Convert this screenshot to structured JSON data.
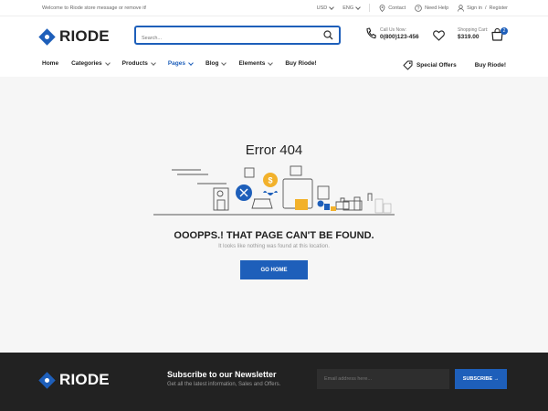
{
  "topbar": {
    "welcome": "Welcome to Riode store message or remove it!",
    "currency": "USD",
    "language": "ENG",
    "contact": "Contact",
    "help": "Need Help",
    "signin": "Sign in",
    "slash": "/",
    "register": "Register"
  },
  "header": {
    "logo": "RIODE",
    "search_placeholder": "Search...",
    "call_label": "Call Us Now:",
    "phone": "0(800)123-456",
    "cart_label": "Shopping Cart:",
    "cart_total": "$319.00",
    "cart_count": "2"
  },
  "nav": {
    "items": [
      {
        "label": "Home"
      },
      {
        "label": "Categories"
      },
      {
        "label": "Products"
      },
      {
        "label": "Pages"
      },
      {
        "label": "Blog"
      },
      {
        "label": "Elements"
      },
      {
        "label": "Buy Riode!"
      }
    ],
    "special_offers": "Special Offers",
    "buy": "Buy Riode!"
  },
  "main": {
    "title": "Error 404",
    "oops": "OOOPPS.! THAT PAGE CAN'T BE FOUND.",
    "sub": "It looks like nothing was found at this location.",
    "button": "GO HOME"
  },
  "footer": {
    "logo": "RIODE",
    "news_title": "Subscribe to our Newsletter",
    "news_sub": "Get all the latest information, Sales and Offers.",
    "email_placeholder": "Email address here...",
    "subscribe": "SUBSCRIBE →"
  },
  "colors": {
    "accent": "#1e5fba",
    "footer": "#222222",
    "background": "#f6f6f6"
  }
}
